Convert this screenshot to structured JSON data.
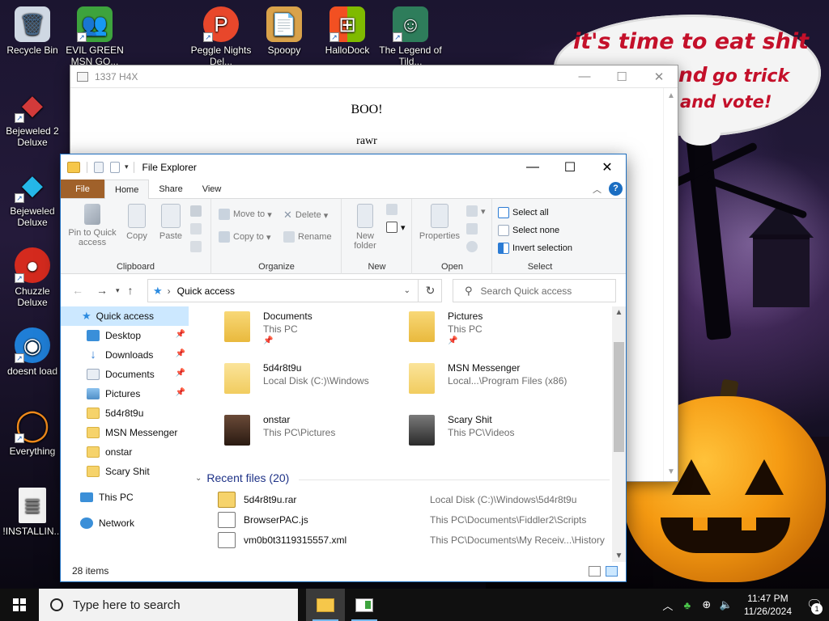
{
  "desktop": {
    "speech": {
      "line1": "it's time to eat shit",
      "line2a": "nd",
      "line2b": "go trick",
      "line3": "and vote!"
    },
    "icons": [
      {
        "label": "Recycle Bin",
        "color": "#cfd8e3",
        "glyph": "🗑"
      },
      {
        "label": "EVIL GREEN MSN GO...",
        "color": "#3da33d",
        "glyph": "👥"
      },
      {
        "label": "Peggle Nights Del...",
        "color": "#e8472b",
        "glyph": "P"
      },
      {
        "label": "Spoopy",
        "color": "#d9a24a",
        "glyph": "📄"
      },
      {
        "label": "HalloDock",
        "color": "#f25022",
        "glyph": "⊞"
      },
      {
        "label": "The Legend of Tild...",
        "color": "#2e7d5b",
        "glyph": "☺"
      },
      {
        "label": "Bejeweled 2 Deluxe",
        "color": "#d23a3a",
        "glyph": "◆"
      },
      {
        "label": "Bejeweled Deluxe",
        "color": "#25b7e8",
        "glyph": "◆"
      },
      {
        "label": "Chuzzle Deluxe",
        "color": "#d42a1e",
        "glyph": "●"
      },
      {
        "label": "doesnt load",
        "color": "#1f7ed6",
        "glyph": "◉"
      },
      {
        "label": "Everything",
        "color": "#f08a1c",
        "glyph": "◯"
      },
      {
        "label": "!INSTALLIN...",
        "color": "#f2f2f2",
        "glyph": "≣"
      }
    ]
  },
  "hax_window": {
    "title": "1337 H4X",
    "line1": "BOO!",
    "line2": "rawr"
  },
  "explorer": {
    "title": "File Explorer",
    "tabs": [
      "File",
      "Home",
      "Share",
      "View"
    ],
    "ribbon": {
      "clipboard": {
        "label": "Clipboard",
        "pin": "Pin to Quick access",
        "copy": "Copy",
        "paste": "Paste"
      },
      "organize": {
        "label": "Organize",
        "move_to": "Move to",
        "copy_to": "Copy to",
        "delete": "Delete",
        "rename": "Rename"
      },
      "new": {
        "label": "New",
        "new_folder": "New folder"
      },
      "open": {
        "label": "Open",
        "properties": "Properties"
      },
      "select": {
        "label": "Select",
        "select_all": "Select all",
        "select_none": "Select none",
        "invert": "Invert selection"
      }
    },
    "address": "Quick access",
    "search_placeholder": "Search Quick access",
    "nav": [
      {
        "label": "Quick access",
        "pinned": false,
        "color": "#2b8be0"
      },
      {
        "label": "Desktop",
        "pinned": true,
        "color": "#3a8fd9"
      },
      {
        "label": "Downloads",
        "pinned": true,
        "color": "#2d7bd2"
      },
      {
        "label": "Documents",
        "pinned": true,
        "color": "#9aa9bd"
      },
      {
        "label": "Pictures",
        "pinned": true,
        "color": "#5aa0d8"
      },
      {
        "label": "5d4r8t9u",
        "pinned": false,
        "color": "#f6d36b"
      },
      {
        "label": "MSN Messenger",
        "pinned": false,
        "color": "#f6d36b"
      },
      {
        "label": "onstar",
        "pinned": false,
        "color": "#f6d36b"
      },
      {
        "label": "Scary Shit",
        "pinned": false,
        "color": "#f6d36b"
      },
      {
        "label": "This PC",
        "pinned": false,
        "color": "#3b8fd8"
      },
      {
        "label": "Network",
        "pinned": false,
        "color": "#3b8fd8"
      }
    ],
    "folders": [
      {
        "name": "Documents",
        "location": "This PC",
        "pinned": true
      },
      {
        "name": "Pictures",
        "location": "This PC",
        "pinned": true
      },
      {
        "name": "5d4r8t9u",
        "location": "Local Disk (C:)\\Windows",
        "pinned": false
      },
      {
        "name": "MSN Messenger",
        "location": "Local...\\Program Files (x86)",
        "pinned": false
      },
      {
        "name": "onstar",
        "location": "This PC\\Pictures",
        "pinned": false
      },
      {
        "name": "Scary Shit",
        "location": "This PC\\Videos",
        "pinned": false
      }
    ],
    "recent_header": "Recent files (20)",
    "recent": [
      {
        "name": "5d4r8t9u.rar",
        "path": "Local Disk (C:)\\Windows\\5d4r8t9u"
      },
      {
        "name": "BrowserPAC.js",
        "path": "This PC\\Documents\\Fiddler2\\Scripts"
      },
      {
        "name": "vm0b0t3119315557.xml",
        "path": "This PC\\Documents\\My Receiv...\\History"
      }
    ],
    "status": "28 items"
  },
  "taskbar": {
    "search_placeholder": "Type here to search",
    "time": "11:47 PM",
    "date": "11/26/2024",
    "notif_count": "1"
  }
}
